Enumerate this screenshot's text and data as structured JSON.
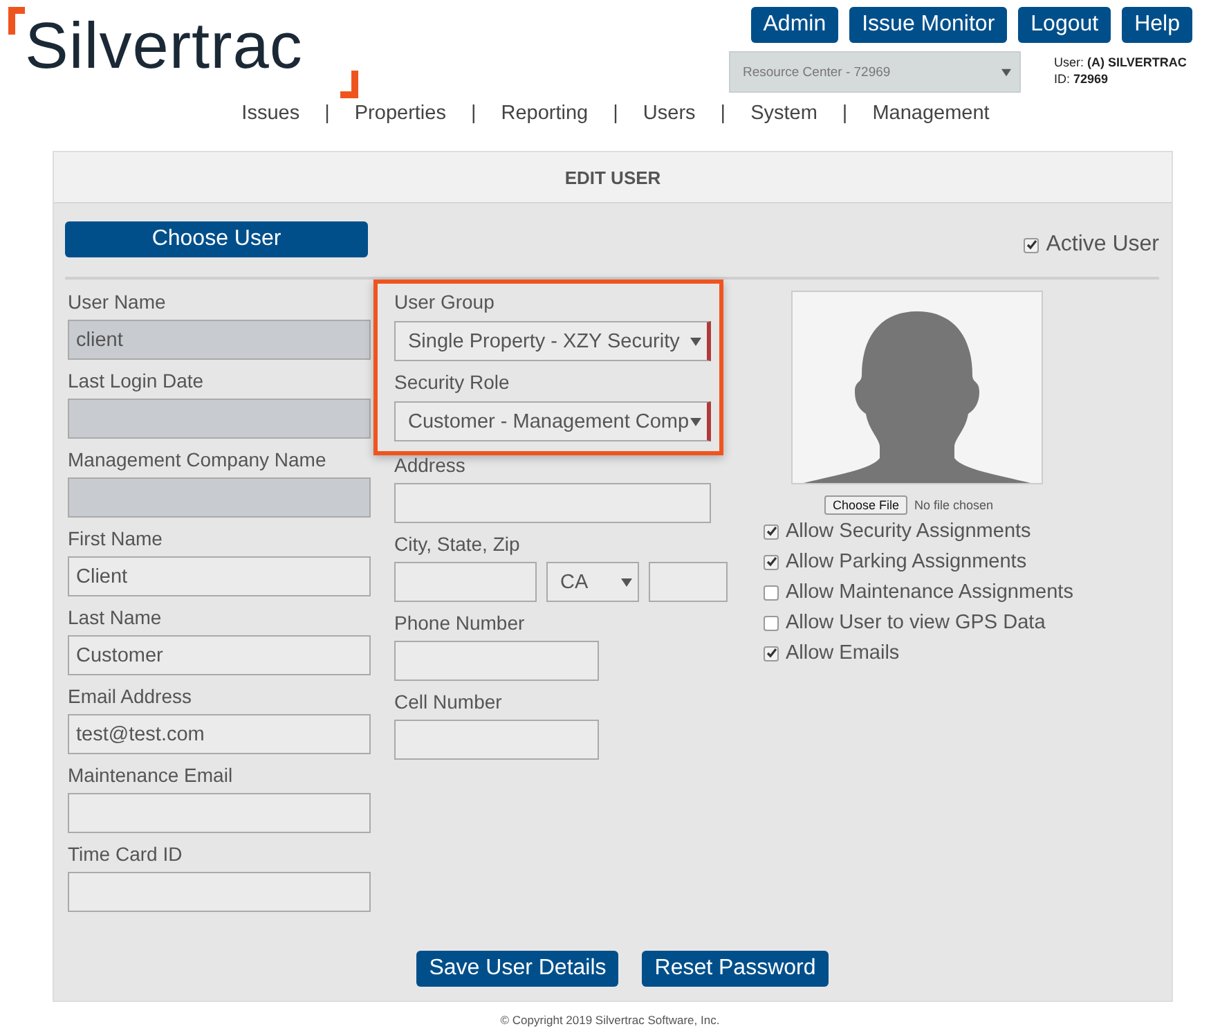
{
  "header": {
    "logo_text": "Silvertrac",
    "top_buttons": [
      "Admin",
      "Issue Monitor",
      "Logout",
      "Help"
    ],
    "resource_select": "Resource Center - 72969",
    "user_label": "User:",
    "user_value": "(A) SILVERTRAC",
    "id_label": "ID:",
    "id_value": "72969"
  },
  "nav": {
    "items": [
      "Issues",
      "Properties",
      "Reporting",
      "Users",
      "System",
      "Management"
    ],
    "separators": [
      "|",
      "|",
      "|",
      "|",
      "|"
    ]
  },
  "panel": {
    "title": "EDIT USER",
    "choose_user_button": "Choose User",
    "active_user": {
      "label": "Active User",
      "checked": true
    },
    "left_fields": [
      {
        "label": "User Name",
        "value": "client",
        "disabled": true
      },
      {
        "label": "Last Login Date",
        "disabled": true
      },
      {
        "label": "Management Company Name",
        "disabled": true
      },
      {
        "label": "First Name",
        "value": "Client",
        "disabled": false
      },
      {
        "label": "Last Name",
        "value": "Customer",
        "disabled": false
      },
      {
        "label": "Email Address",
        "value": "test@test.com",
        "disabled": false
      },
      {
        "label": "Maintenance Email",
        "disabled": false
      },
      {
        "label": "Time Card ID",
        "disabled": false
      }
    ],
    "highlighted_fields": [
      {
        "label": "User Group",
        "value": "Single Property - XZY Security"
      },
      {
        "label": "Security Role",
        "value": "Customer - Management Comp"
      }
    ],
    "middle_fields": [
      {
        "kind": "text",
        "label": "Address"
      },
      {
        "kind": "city_state_zip",
        "label": "City, State, Zip",
        "state": "CA"
      },
      {
        "kind": "short_text",
        "label": "Phone Number"
      },
      {
        "kind": "short_text",
        "label": "Cell Number"
      }
    ],
    "file_button": "Choose File",
    "file_status": "No file chosen",
    "permissions": [
      {
        "label": "Allow Security Assignments",
        "checked": true
      },
      {
        "label": "Allow Parking Assignments",
        "checked": true
      },
      {
        "label": "Allow Maintenance Assignments",
        "checked": false
      },
      {
        "label": "Allow User to view GPS Data",
        "checked": false
      },
      {
        "label": "Allow Emails",
        "checked": true
      }
    ],
    "buttons": [
      "Save User Details",
      "Reset Password"
    ]
  },
  "copyright": "© Copyright 2019 Silvertrac Software, Inc."
}
